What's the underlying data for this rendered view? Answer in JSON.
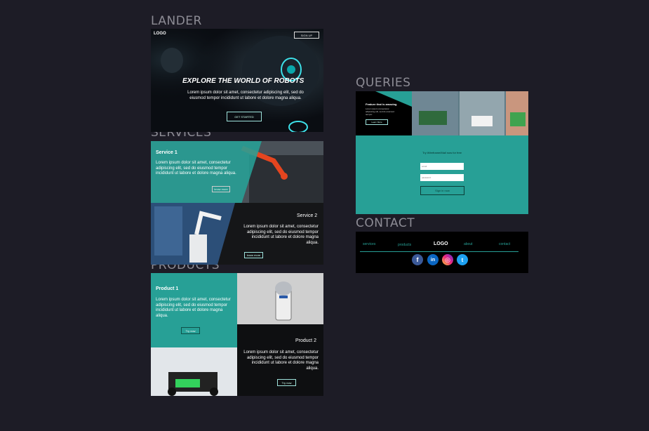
{
  "sections": {
    "lander": "LANDER",
    "services": "SERVICES",
    "products": "PRODUCTS",
    "queries": "QUERIES",
    "contact": "CONTACT"
  },
  "lander": {
    "logo": "LOGO",
    "top_button": "SIGN UP",
    "headline": "EXPLORE THE WORLD OF ROBOTS",
    "body": "Lorem ipsum dolor sit amet, consectetur adipiscing elit, sed do eiusmod tempor incididunt ut labore et dolore magna aliqua.",
    "cta": "GET STARTED"
  },
  "services": [
    {
      "title": "Service 1",
      "body": "Lorem ipsum dolor sit amet, consectetur adipiscing elit, sed do eiusmod tempor incididunt ut labore et dolore magna aliqua.",
      "button": "know more"
    },
    {
      "title": "Service 2",
      "body": "Lorem ipsum dolor sit amet, consectetur adipiscing elit, sed do eiusmod tempor incididunt ut labore et dolore magna aliqua.",
      "button": "know more"
    }
  ],
  "products": [
    {
      "title": "Product 1",
      "body": "Lorem ipsum dolor sit amet, consectetur adipiscing elit, sed do eiusmod tempor incididunt ut labore et dolore magna aliqua.",
      "button": "Try now"
    },
    {
      "title": "Product 2",
      "body": "Lorem ipsum dolor sit amet, consectetur adipiscing elit, sed do eiusmod tempor incididunt ut labore et dolore magna aliqua.",
      "button": "Try now"
    }
  ],
  "queries": {
    "feature_title": "Feature that is amazing",
    "feature_body": "Lorem ipsum consectetur adipiscing elit, sed do eiusmod tempor.",
    "feature_button": "Learn More",
    "form_title": "Try Wireframe/Mail now for free",
    "email_placeholder": "email",
    "password_placeholder": "password",
    "submit": "Sign in now"
  },
  "contact": {
    "links": [
      "services",
      "products",
      "about",
      "contact"
    ],
    "logo": "LOGO",
    "social": [
      {
        "name": "facebook",
        "glyph": "f",
        "color": "#3b5998"
      },
      {
        "name": "linkedin",
        "glyph": "in",
        "color": "#0a66c2"
      },
      {
        "name": "instagram",
        "glyph": "◎",
        "color": "#d6249f"
      },
      {
        "name": "twitter",
        "glyph": "t",
        "color": "#1da1f2"
      }
    ]
  }
}
